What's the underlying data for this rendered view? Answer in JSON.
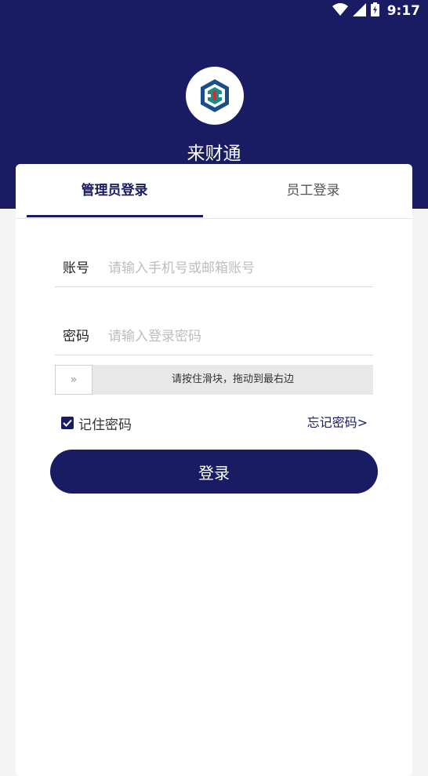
{
  "status_bar": {
    "time": "9:17",
    "icons": [
      "wifi-icon",
      "signal-icon",
      "battery-icon"
    ]
  },
  "app": {
    "name": "来财通",
    "logo_icon": "app-logo-icon"
  },
  "tabs": {
    "admin": "管理员登录",
    "staff": "员工登录",
    "active": "admin"
  },
  "form": {
    "account_label": "账号",
    "account_placeholder": "请输入手机号或邮箱账号",
    "account_value": "",
    "password_label": "密码",
    "password_placeholder": "请输入登录密码",
    "password_value": ""
  },
  "slider": {
    "handle_glyph": "»",
    "hint": "请按住滑块，拖动到最右边"
  },
  "remember": {
    "label": "记住密码",
    "checked": true
  },
  "forgot_label": "忘记密码>",
  "login_label": "登录",
  "colors": {
    "primary": "#191c63",
    "background": "#f4f4f4",
    "card": "#ffffff"
  }
}
